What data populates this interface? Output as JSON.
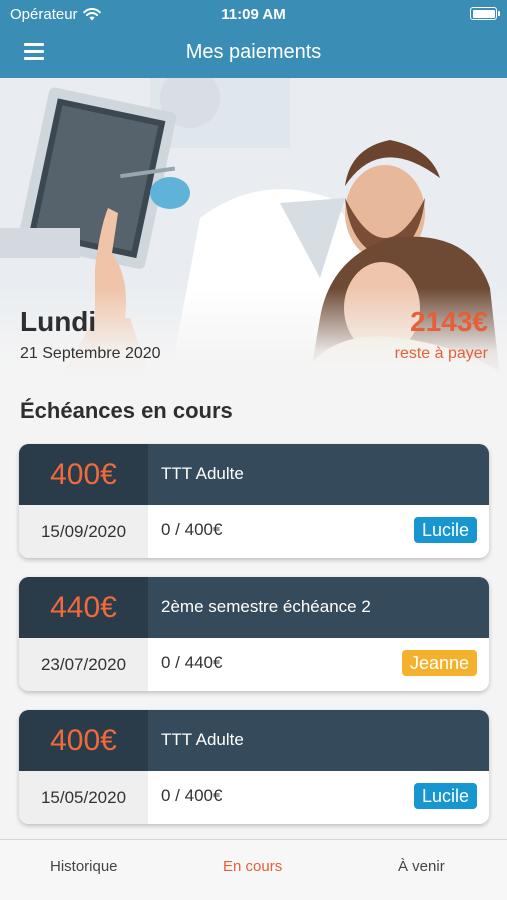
{
  "status_bar": {
    "carrier": "Opérateur",
    "time": "11:09 AM"
  },
  "navbar": {
    "title": "Mes paiements",
    "menu_icon": "hamburger-menu-icon"
  },
  "hero": {
    "day": "Lundi",
    "date": "21 Septembre 2020",
    "amount": "2143€",
    "amount_label": "reste à payer"
  },
  "section": {
    "title": "Échéances en cours"
  },
  "cards": [
    {
      "price": "400€",
      "label": "TTT Adulte",
      "date": "15/09/2020",
      "progress": "0 / 400€",
      "badge": "Lucile",
      "badge_color": "#1896cf"
    },
    {
      "price": "440€",
      "label": "2ème semestre échéance 2",
      "date": "23/07/2020",
      "progress": "0 / 440€",
      "badge": "Jeanne",
      "badge_color": "#f3b12e"
    },
    {
      "price": "400€",
      "label": "TTT Adulte",
      "date": "15/05/2020",
      "progress": "0 / 400€",
      "badge": "Lucile",
      "badge_color": "#1896cf"
    }
  ],
  "tabs": [
    {
      "label": "Historique",
      "active": false
    },
    {
      "label": "En cours",
      "active": true
    },
    {
      "label": "À venir",
      "active": false
    }
  ],
  "colors": {
    "brand": "#3a8db5",
    "accent": "#e5603a",
    "card_dark": "#354a5a"
  }
}
